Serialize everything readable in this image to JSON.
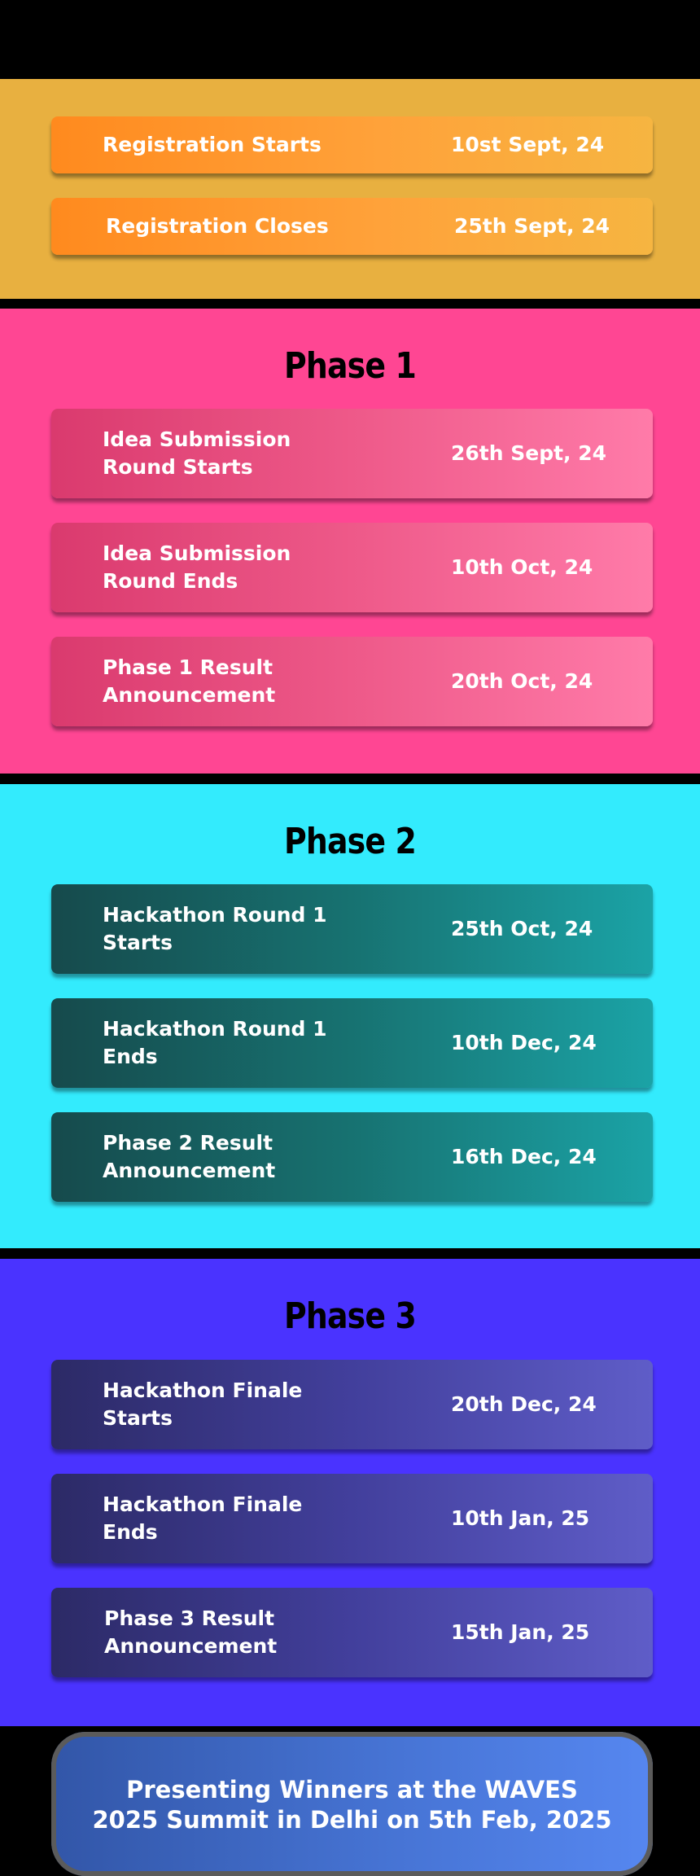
{
  "registration": {
    "items": [
      {
        "label": "Registration Starts",
        "date": "10st Sept, 24"
      },
      {
        "label": "Registration Closes",
        "date": "25th Sept, 24"
      }
    ]
  },
  "phases": [
    {
      "title": "Phase 1",
      "items": [
        {
          "label": "Idea Submission Round Starts",
          "date": "26th Sept, 24"
        },
        {
          "label": "Idea Submission Round Ends",
          "date": "10th Oct, 24"
        },
        {
          "label": "Phase 1 Result Announcement",
          "date": "20th Oct, 24"
        }
      ]
    },
    {
      "title": "Phase 2",
      "items": [
        {
          "label": "Hackathon Round 1 Starts",
          "date": "25th Oct, 24"
        },
        {
          "label": "Hackathon Round 1 Ends",
          "date": "10th Dec, 24"
        },
        {
          "label": "Phase 2 Result Announcement",
          "date": "16th Dec, 24"
        }
      ]
    },
    {
      "title": "Phase 3",
      "items": [
        {
          "label": "Hackathon Finale Starts",
          "date": "20th Dec, 24"
        },
        {
          "label": "Hackathon Finale Ends",
          "date": "10th Jan, 25"
        },
        {
          "label": "Phase 3 Result Announcement",
          "date": "15th Jan, 25"
        }
      ]
    }
  ],
  "finale": {
    "line1": "Presenting Winners at the WAVES",
    "line2": "2025 Summit in Delhi on 5th Feb, 2025"
  },
  "colors": {
    "registration_bg": "#E8B040",
    "phase1_bg": "#FF4693",
    "phase2_bg": "#33EBFD",
    "phase3_bg": "#4A33FF",
    "page_bg": "#000000"
  }
}
